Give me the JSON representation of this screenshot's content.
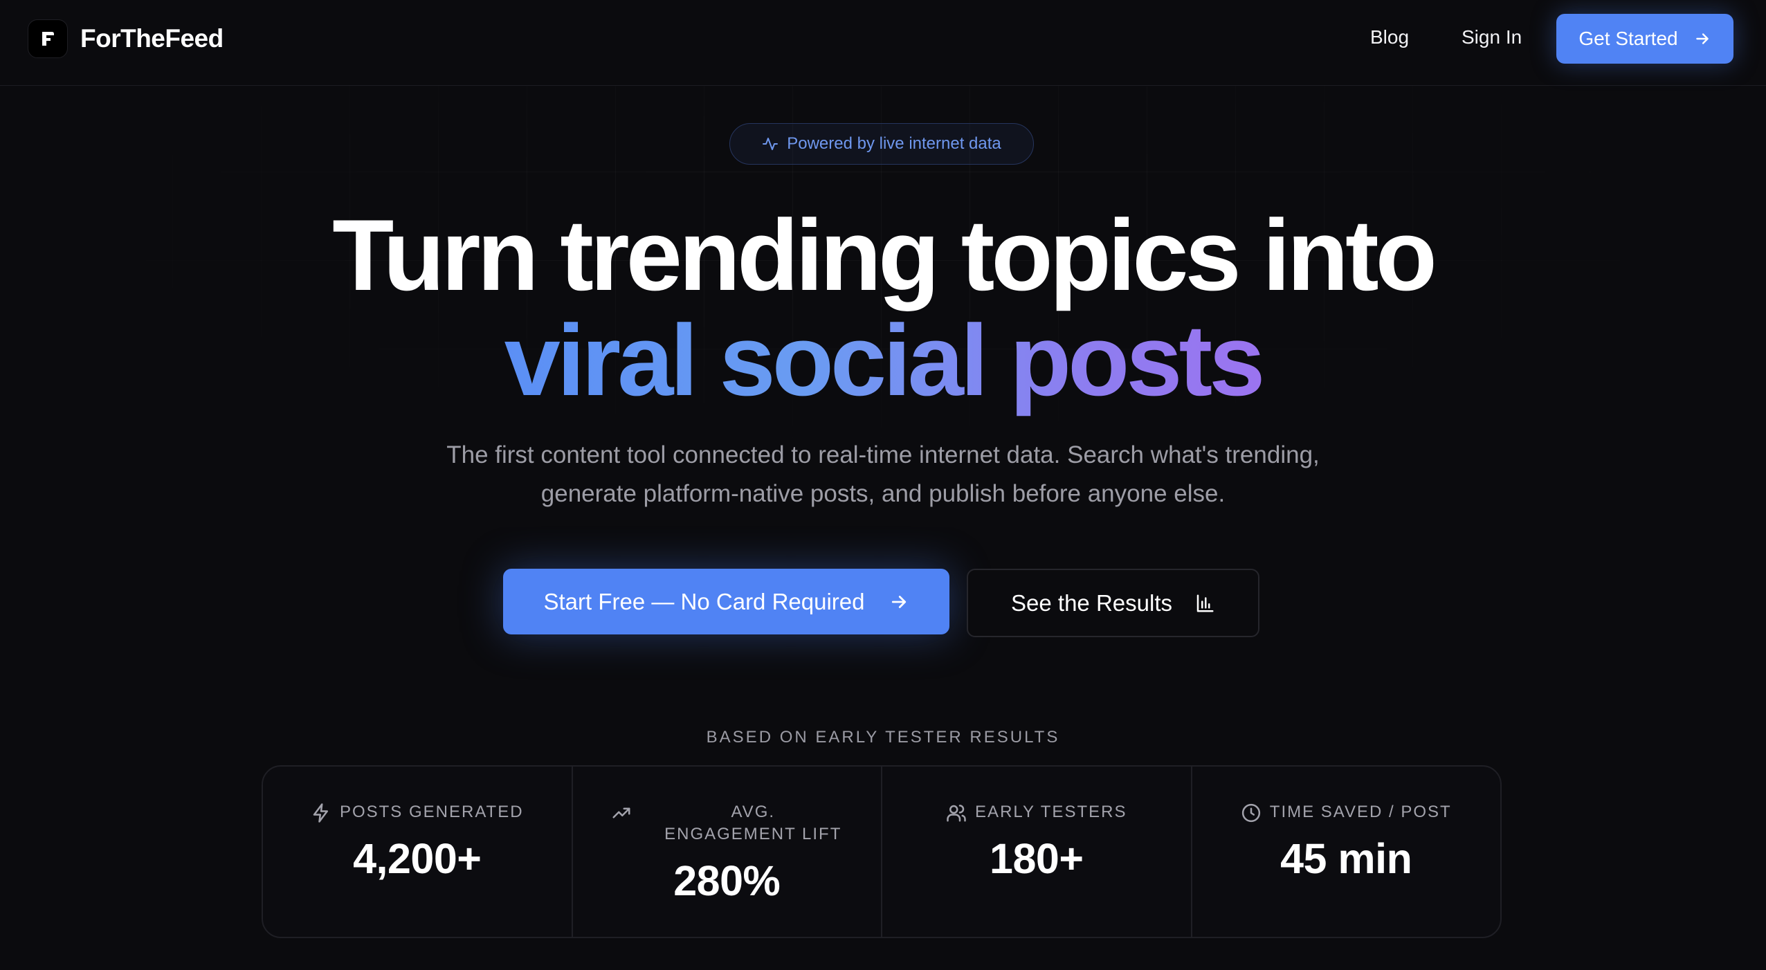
{
  "nav": {
    "brand": "ForTheFeed",
    "links": [
      "Blog",
      "Sign In"
    ],
    "cta": "Get Started"
  },
  "hero": {
    "badge": "Powered by live internet data",
    "headline_line1": "Turn trending topics into",
    "headline_line2": "viral social posts",
    "subtitle_line1": "The first content tool connected to real-time internet data. Search what's trending,",
    "subtitle_line2": "generate platform-native posts, and publish before anyone else.",
    "primary_cta": "Start Free — No Card Required",
    "secondary_cta": "See the Results"
  },
  "results": {
    "label": "BASED ON EARLY TESTER RESULTS",
    "stats": [
      {
        "label": "POSTS GENERATED",
        "value": "4,200+",
        "icon": "zap-icon"
      },
      {
        "label": "AVG. ENGAGEMENT LIFT",
        "value": "280%",
        "icon": "trending-up-icon"
      },
      {
        "label": "EARLY TESTERS",
        "value": "180+",
        "icon": "users-icon"
      },
      {
        "label": "TIME SAVED / POST",
        "value": "45 min",
        "icon": "clock-icon"
      }
    ]
  },
  "colors": {
    "background": "#0b0b0e",
    "accent": "#5083f4",
    "gradient_start": "#5b8ff5",
    "gradient_end": "#9b74f0",
    "muted_text": "#9d9da6"
  }
}
